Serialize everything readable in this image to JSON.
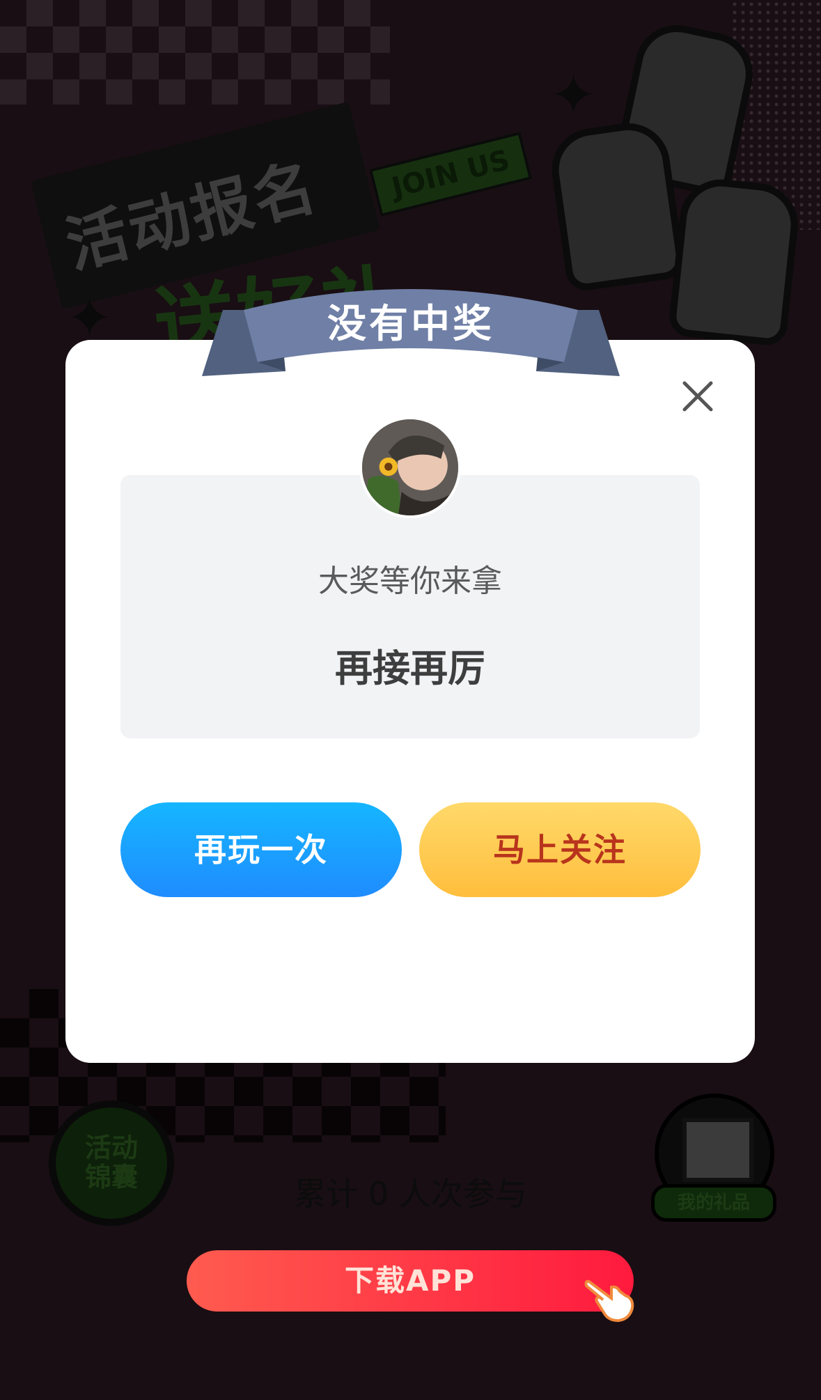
{
  "background": {
    "banner_text": "活动报名",
    "join_tag": "JOIN US",
    "green_text": "送好礼",
    "left_badge": "活动\n锦囊",
    "gift_label": "我的礼品",
    "participants": {
      "prefix": "累计",
      "count": "0",
      "suffix": "人次参与"
    },
    "download_label": "下载APP"
  },
  "modal": {
    "title": "没有中奖",
    "subtitle": "大奖等你来拿",
    "headline": "再接再厉",
    "play_again_label": "再玩一次",
    "follow_label": "马上关注",
    "close_icon": "close-icon",
    "colors": {
      "ribbon": "#6d7ea3",
      "play_again": "#1f9bff",
      "follow": "#ffcd55",
      "follow_text": "#b8341c"
    }
  }
}
